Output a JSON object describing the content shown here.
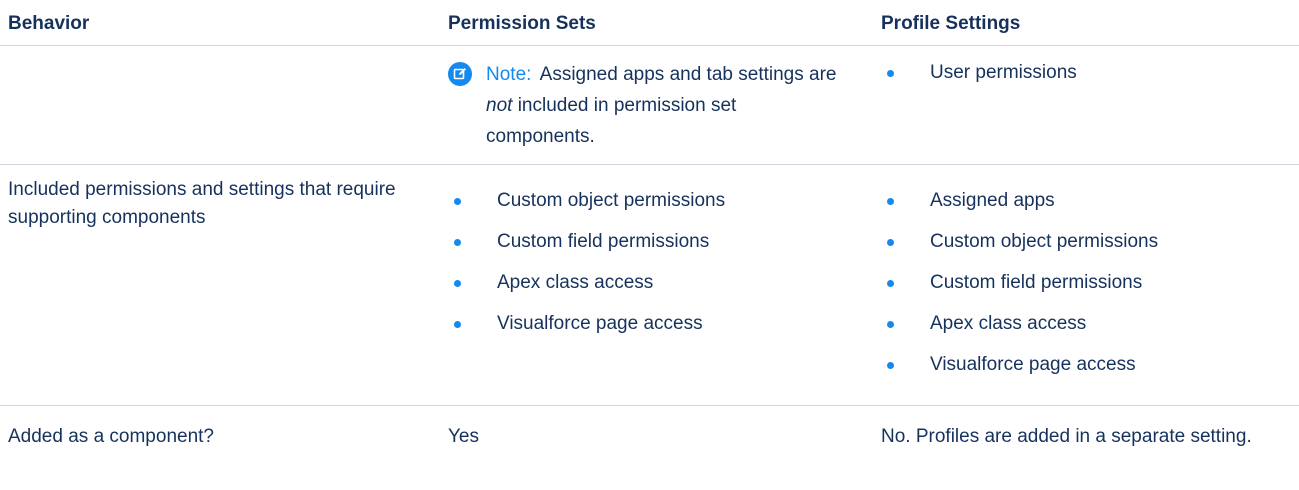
{
  "headers": {
    "behavior": "Behavior",
    "permission_sets": "Permission Sets",
    "profile_settings": "Profile Settings"
  },
  "row1": {
    "behavior": "",
    "note_label": "Note:",
    "note_before": "Assigned apps and tab settings are",
    "note_emphasis": "not",
    "note_after": "included in permission set components.",
    "profile_items": [
      "User permissions"
    ]
  },
  "row2": {
    "behavior": "Included permissions and settings that require supporting components",
    "permission_items": [
      "Custom object permissions",
      "Custom field permissions",
      "Apex class access",
      "Visualforce page access"
    ],
    "profile_items": [
      "Assigned apps",
      "Custom object permissions",
      "Custom field permissions",
      "Apex class access",
      "Visualforce page access"
    ]
  },
  "row3": {
    "behavior": "Added as a component?",
    "permission_sets": "Yes",
    "profile_settings": "No. Profiles are added in a separate setting."
  },
  "colors": {
    "text": "#16325c",
    "accent": "#1589ee",
    "divider": "#cfd6de"
  },
  "icons": {
    "note": "edit-note-icon",
    "bullet": "bullet-dot"
  }
}
